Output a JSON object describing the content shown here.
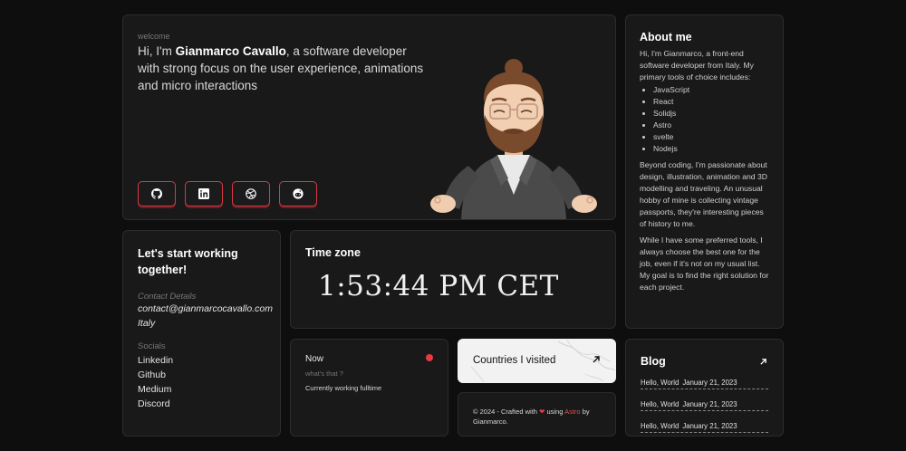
{
  "hero": {
    "kicker": "welcome",
    "intro_prefix": "Hi, I'm ",
    "name": "Gianmarco Cavallo",
    "intro_suffix": ", a software developer with strong focus on the user experience, animations and micro interactions",
    "socials": [
      "github-icon",
      "linkedin-icon",
      "dribbble-icon",
      "reddit-icon"
    ]
  },
  "about": {
    "title": "About me",
    "intro": "Hi, I'm Gianmarco, a front-end software developer from Italy. My primary tools of choice includes:",
    "tools": [
      "JavaScript",
      "React",
      "Solidjs",
      "Astro",
      "svelte",
      "Nodejs"
    ],
    "para2": "Beyond coding, I'm passionate about design, illustration, animation and 3D modelling and traveling. An unusual hobby of mine is collecting vintage passports, they're interesting pieces of history to me.",
    "para3": "While I have some preferred tools, I always choose the best one for the job, even if it's not on my usual list. My goal is to find the right solution for each project."
  },
  "contact": {
    "title": "Let's start working together!",
    "details_label": "Contact Details",
    "email": "contact@gianmarcocavallo.com",
    "location": "Italy",
    "socials_label": "Socials",
    "links": [
      "Linkedin",
      "Github",
      "Medium",
      "Discord"
    ]
  },
  "timezone": {
    "title": "Time zone",
    "time": "1:53:44 PM CET"
  },
  "now": {
    "title": "Now",
    "question": "what's that ?",
    "status": "Currently working fulltime",
    "dot_color": "#e23b42"
  },
  "countries": {
    "title": "Countries I visited"
  },
  "footer": {
    "prefix": "© 2024 - Crafted with",
    "middle": "using",
    "astro": "Astro",
    "suffix": "by Gianmarco."
  },
  "blog": {
    "title": "Blog",
    "posts": [
      {
        "title": "Hello, World",
        "date": "January 21, 2023"
      },
      {
        "title": "Hello, World",
        "date": "January 21, 2023"
      },
      {
        "title": "Hello, World",
        "date": "January 21, 2023"
      }
    ]
  },
  "colors": {
    "accent": "#d83a44",
    "background": "#0e0e0e",
    "card": "#191919"
  }
}
